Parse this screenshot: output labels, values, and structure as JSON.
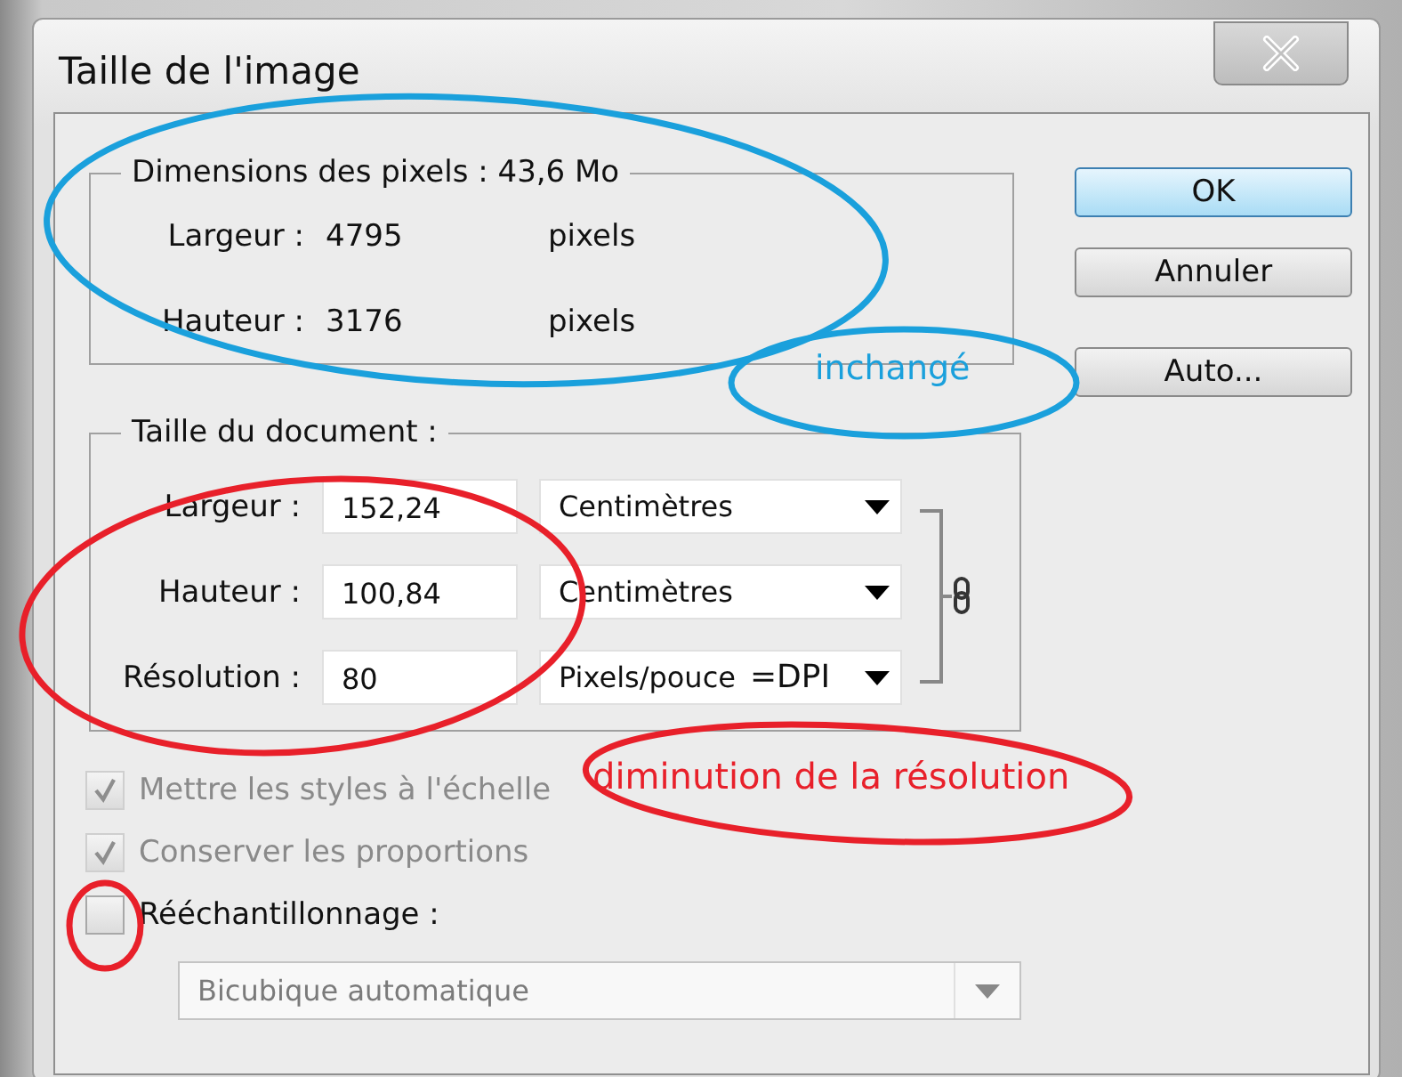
{
  "window": {
    "title": "Taille de l'image"
  },
  "pixel_dimensions": {
    "legend": "Dimensions des pixels : 43,6 Mo",
    "rows": [
      {
        "label": "Largeur :",
        "value": "4795",
        "unit": "pixels"
      },
      {
        "label": "Hauteur :",
        "value": "3176",
        "unit": "pixels"
      }
    ]
  },
  "document_size": {
    "legend": "Taille du document :",
    "linked": true,
    "rows": [
      {
        "label": "Largeur :",
        "value": "152,24",
        "unit": "Centimètres"
      },
      {
        "label": "Hauteur :",
        "value": "100,84",
        "unit": "Centimètres"
      },
      {
        "label": "Résolution :",
        "value": "80",
        "unit": "Pixels/pouce",
        "note": "=DPI"
      }
    ]
  },
  "options": [
    {
      "label": "Mettre les styles à l'échelle",
      "checked": true,
      "disabled": true
    },
    {
      "label": "Conserver les proportions",
      "checked": true,
      "disabled": true
    },
    {
      "label": "Rééchantillonnage :",
      "checked": false,
      "disabled": false
    }
  ],
  "resample_method": {
    "value": "Bicubique automatique",
    "disabled": true
  },
  "buttons": [
    {
      "label": "OK",
      "default": true
    },
    {
      "label": "Annuler",
      "default": false
    },
    {
      "label": "Auto...",
      "default": false
    }
  ],
  "annotations": {
    "ellipses": [
      {
        "color": "#1aa0dc"
      },
      {
        "color": "#1aa0dc"
      },
      {
        "color": "#e8202a"
      },
      {
        "color": "#e8202a"
      },
      {
        "color": "#e8202a"
      }
    ],
    "notes": [
      {
        "text": "inchangé",
        "color": "#1aa0dc"
      },
      {
        "text": "diminution de la résolution",
        "color": "#e8202a"
      }
    ]
  }
}
